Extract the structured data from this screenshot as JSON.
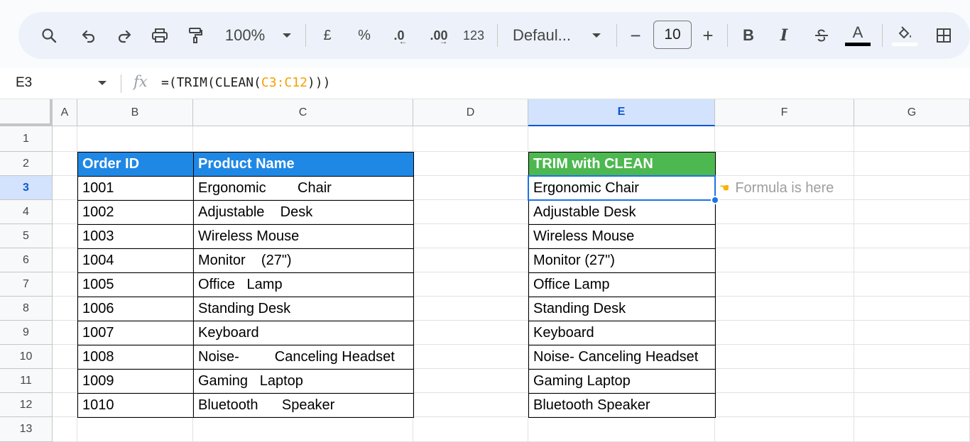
{
  "toolbar": {
    "zoom": "100%",
    "currency_label": "£",
    "percent_label": "%",
    "decrease_decimal_label": ".0",
    "increase_decimal_label": ".00",
    "number_format_label": "123",
    "font_name": "Defaul...",
    "font_size": "10",
    "minus_label": "−",
    "plus_label": "+",
    "bold_label": "B",
    "italic_label": "I",
    "text_color_label": "A"
  },
  "formula_bar": {
    "cell_ref": "E3",
    "fx_label": "fx",
    "formula_prefix": "=(TRIM(CLEAN(",
    "formula_ref": "C3:C12",
    "formula_suffix": ")))"
  },
  "columns": [
    "A",
    "B",
    "C",
    "D",
    "E",
    "F",
    "G"
  ],
  "selected_column": "E",
  "rows": [
    "1",
    "2",
    "3",
    "4",
    "5",
    "6",
    "7",
    "8",
    "9",
    "10",
    "11",
    "12",
    "13"
  ],
  "selected_row": "3",
  "table1": {
    "headers": [
      "Order ID",
      "Product Name"
    ],
    "rows": [
      [
        "1001",
        "Ergonomic        Chair"
      ],
      [
        "1002",
        "Adjustable    Desk"
      ],
      [
        "1003",
        "Wireless Mouse"
      ],
      [
        "1004",
        "Monitor    (27\")"
      ],
      [
        "1005",
        "Office   Lamp"
      ],
      [
        "1006",
        "Standing Desk"
      ],
      [
        "1007",
        "Keyboard"
      ],
      [
        "1008",
        "Noise-         Canceling Headset"
      ],
      [
        "1009",
        "Gaming   Laptop"
      ],
      [
        "1010",
        "Bluetooth      Speaker"
      ]
    ]
  },
  "table2": {
    "header": "TRIM with CLEAN",
    "rows": [
      "Ergonomic Chair",
      "Adjustable Desk",
      "Wireless Mouse",
      "Monitor (27\")",
      "Office Lamp",
      "Standing Desk",
      "Keyboard",
      "Noise- Canceling Headset",
      "Gaming Laptop",
      "Bluetooth Speaker"
    ]
  },
  "note": {
    "icon": "pointing-hand-icon",
    "text": "Formula is here"
  },
  "colors": {
    "header_blue": "#1f88e5",
    "header_green": "#4cb84f",
    "selection_blue": "#1a73e8",
    "formula_ref_orange": "#f4a000"
  }
}
